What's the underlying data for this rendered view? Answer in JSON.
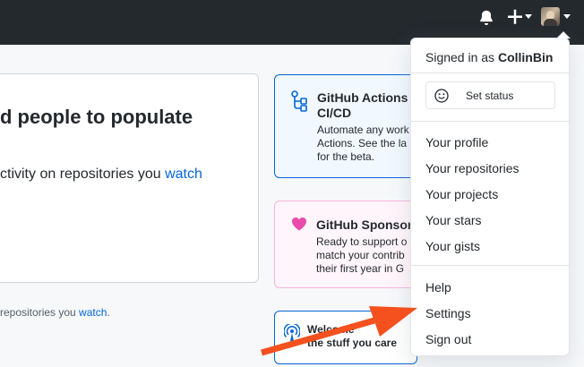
{
  "header": {
    "icons": [
      "bell-icon",
      "plus-icon",
      "chevron-down-icon",
      "avatar",
      "chevron-down-icon"
    ]
  },
  "main": {
    "title": "d people to populate",
    "text_before": "ctivity on repositories you ",
    "text_link": "watch"
  },
  "footer": {
    "text_before": "repositories you ",
    "text_link": "watch",
    "text_after": "."
  },
  "cards": {
    "actions": {
      "title_line1": "GitHub Actions",
      "title_line2": "CI/CD",
      "desc_line1": "Automate any work",
      "desc_line2": "Actions. See the la",
      "desc_line3": "for the beta.",
      "icon": "workflow-icon"
    },
    "sponsors": {
      "title": "GitHub Sponsor",
      "desc_line1": "Ready to support o",
      "desc_line2": "match your contrib",
      "desc_line3": "their first year in G",
      "icon": "heart-icon"
    },
    "welcome": {
      "line1": "Welcome",
      "line2": "the stuff you care",
      "icon": "broadcast-icon"
    }
  },
  "dropdown": {
    "signed_in_prefix": "Signed in as ",
    "username": "CollinBin",
    "set_status": "Set status",
    "items_group1": [
      "Your profile",
      "Your repositories",
      "Your projects",
      "Your stars",
      "Your gists"
    ],
    "items_group2": [
      "Help",
      "Settings",
      "Sign out"
    ]
  },
  "annotation": {
    "arrow_color": "#f4511e"
  },
  "colors": {
    "header_bg": "#24292e",
    "link": "#0366d6",
    "sponsor_heart": "#ea4aaa"
  }
}
